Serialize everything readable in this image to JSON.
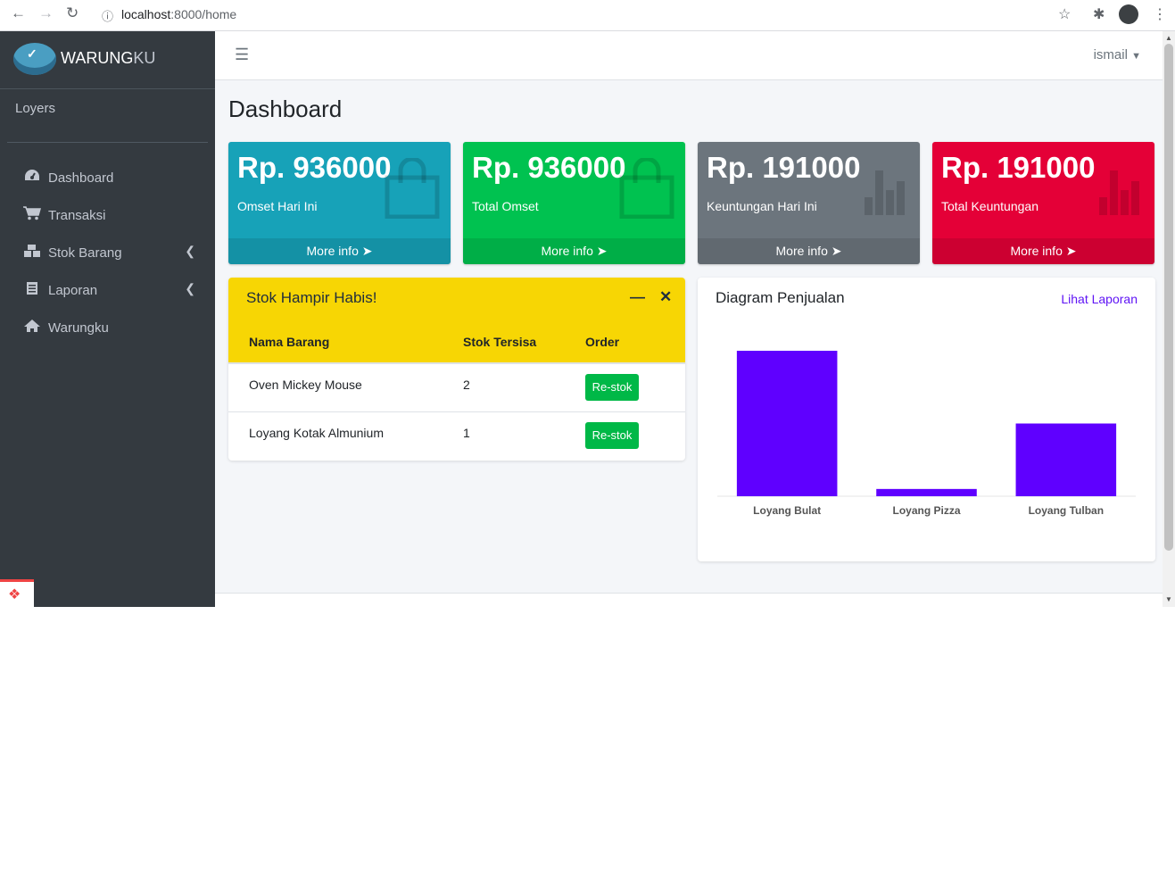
{
  "browser": {
    "url_host": "localhost",
    "url_path": ":8000/home"
  },
  "sidebar": {
    "brand_bold": "WARUNG",
    "brand_thin": "KU",
    "brand_logo_text": "Warungku",
    "user_name": "Loyers",
    "items": [
      {
        "label": "Dashboard",
        "icon": "tachometer-icon"
      },
      {
        "label": "Transaksi",
        "icon": "cart-icon"
      },
      {
        "label": "Stok Barang",
        "icon": "cubes-icon",
        "has_submenu": true
      },
      {
        "label": "Laporan",
        "icon": "list-icon",
        "has_submenu": true
      },
      {
        "label": "Warungku",
        "icon": "home-icon"
      }
    ]
  },
  "topnav": {
    "user_label": "ismail"
  },
  "page": {
    "title": "Dashboard"
  },
  "info_boxes": [
    {
      "amount": "Rp. 936000",
      "caption": "Omset Hari Ini",
      "footer": "More info",
      "color": "#17a2b8",
      "icon": "shopping-bag-icon"
    },
    {
      "amount": "Rp. 936000",
      "caption": "Total Omset",
      "footer": "More info",
      "color": "#00c250",
      "icon": "shopping-bag-icon"
    },
    {
      "amount": "Rp. 191000",
      "caption": "Keuntungan Hari Ini",
      "footer": "More info",
      "color": "#6c757d",
      "icon": "bar-chart-icon"
    },
    {
      "amount": "Rp. 191000",
      "caption": "Total Keuntungan",
      "footer": "More info",
      "color": "#e40037",
      "icon": "bar-chart-icon"
    }
  ],
  "stock_card": {
    "title": "Stok Hampir Habis!",
    "header_color": "#f7d604",
    "columns": [
      "Nama Barang",
      "Stok Tersisa",
      "Order"
    ],
    "rows": [
      {
        "name": "Oven Mickey Mouse",
        "stock": "2",
        "action": "Re-stok"
      },
      {
        "name": "Loyang Kotak Almunium",
        "stock": "1",
        "action": "Re-stok"
      }
    ]
  },
  "chart_card": {
    "title": "Diagram Penjualan",
    "link": "Lihat Laporan"
  },
  "chart_data": {
    "type": "bar",
    "categories": [
      "Loyang Bulat",
      "Loyang Pizza",
      "Loyang Tulban"
    ],
    "values": [
      20,
      1,
      10
    ],
    "ylim": [
      0,
      20
    ],
    "color": "#5f00ff",
    "grid": false,
    "title": "",
    "xlabel": "",
    "ylabel": ""
  }
}
